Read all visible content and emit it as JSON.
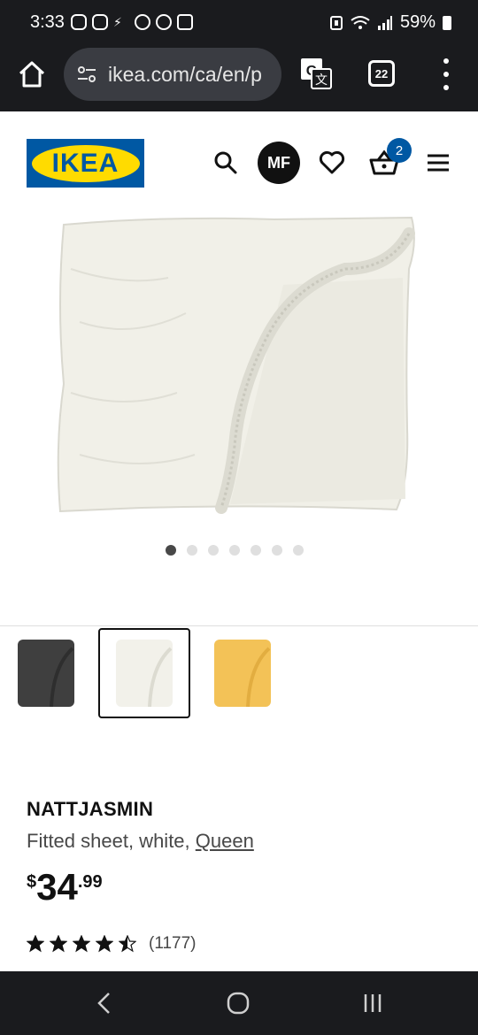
{
  "status_bar": {
    "time": "3:33",
    "battery": "59%"
  },
  "browser": {
    "url": "ikea.com/ca/en/p",
    "tab_count": "22"
  },
  "header": {
    "logo_text": "IKEA",
    "avatar_initials": "MF",
    "cart_count": "2"
  },
  "gallery": {
    "total_images": 7,
    "active_index": 0
  },
  "variants": [
    {
      "color_name": "dark grey",
      "color": "#3f3f3f",
      "selected": false
    },
    {
      "color_name": "white",
      "color": "#f2f1ea",
      "selected": true
    },
    {
      "color_name": "yellow",
      "color": "#f3c257",
      "selected": false
    }
  ],
  "product": {
    "name": "NATTJASMIN",
    "desc_prefix": "Fitted sheet, white, ",
    "size": "Queen",
    "price_currency": "$",
    "price_main": "34",
    "price_cents": ".99",
    "rating": 4.5,
    "review_count": "(1177)"
  },
  "colors": {
    "ikea_blue": "#0058a3",
    "ikea_yellow": "#ffdb00",
    "dark_bar": "#1a1b1e"
  }
}
